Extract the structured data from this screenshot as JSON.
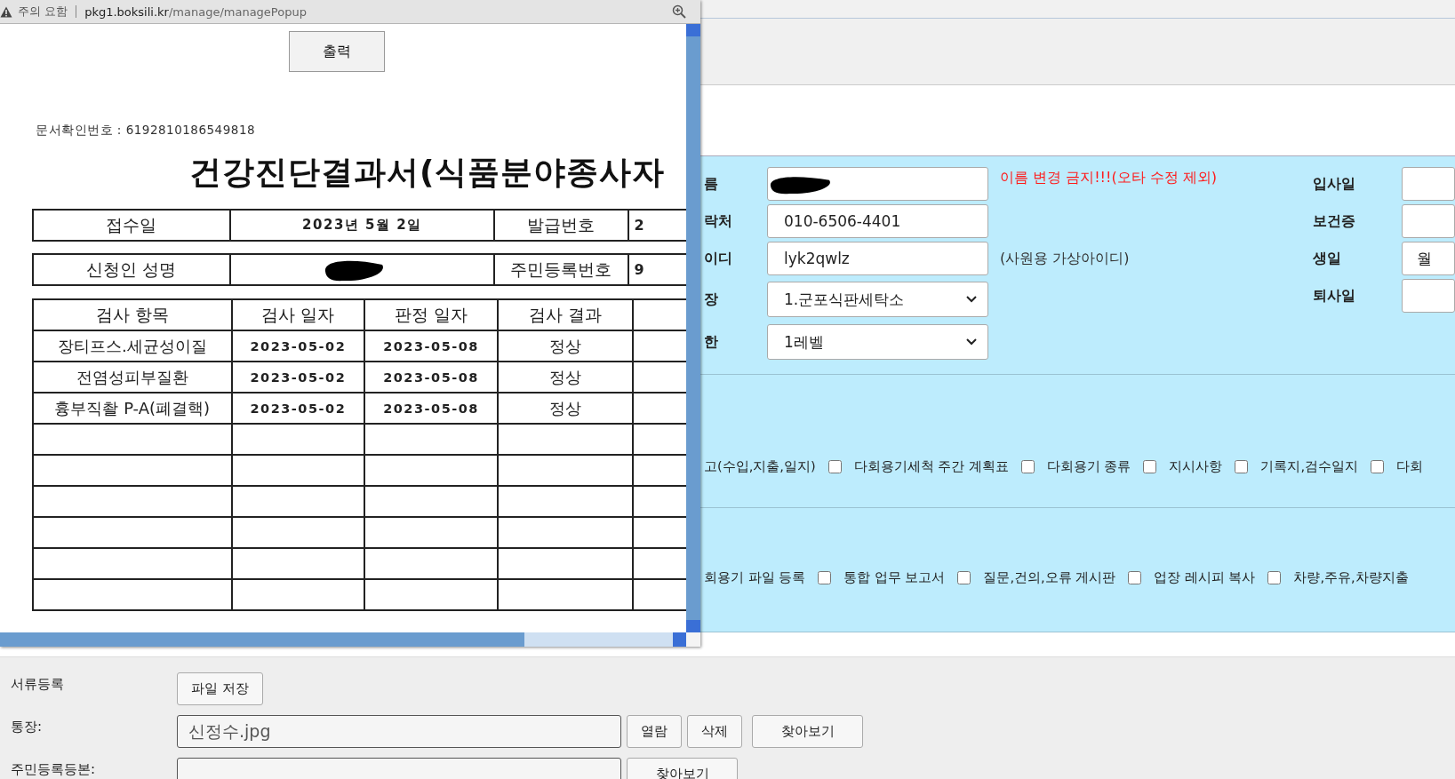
{
  "popup": {
    "security_label": "주의 요함",
    "url_host": "pkg1.boksili.kr",
    "url_path": "/manage/managePopup",
    "print_button": "출력",
    "doc_number": "문서확인번호 : 6192810186549818",
    "title": "건강진단결과서(식품분야종사자",
    "info_rows": [
      [
        {
          "kind": "label",
          "text": "접수일"
        },
        {
          "kind": "value",
          "text": "2023년 5월 2일"
        },
        {
          "kind": "label",
          "text": "발급번호"
        },
        {
          "kind": "cut",
          "text": "2"
        }
      ],
      [
        {
          "kind": "label",
          "text": "신청인 성명"
        },
        {
          "kind": "redacted"
        },
        {
          "kind": "label",
          "text": "주민등록번호"
        },
        {
          "kind": "cut",
          "text": "9"
        }
      ]
    ],
    "results": {
      "columns": [
        "검사 항목",
        "검사 일자",
        "판정 일자",
        "검사 결과"
      ],
      "rows": [
        [
          "장티프스.세균성이질",
          "2023-05-02",
          "2023-05-08",
          "정상"
        ],
        [
          "전염성피부질환",
          "2023-05-02",
          "2023-05-08",
          "정상"
        ],
        [
          "흉부직촬 P-A(폐결핵)",
          "2023-05-02",
          "2023-05-08",
          "정상"
        ]
      ]
    }
  },
  "form": {
    "fields": [
      {
        "label": "름",
        "kind": "redacted",
        "note": {
          "kind": "warning",
          "text": "이름 변경 금지!!!(오타 수정 제외)"
        }
      },
      {
        "label": "락처",
        "kind": "text",
        "value": "010-6506-4401"
      },
      {
        "label": "이디",
        "kind": "text",
        "value": "lyk2qwlz",
        "note": {
          "kind": "hint",
          "text": "(사원용 가상아이디)"
        }
      },
      {
        "label": "장",
        "kind": "select",
        "value": "1.군포식판세탁소"
      },
      {
        "label": "한",
        "kind": "select",
        "value": "1레벨"
      }
    ],
    "right_fields": [
      {
        "label": "입사일"
      },
      {
        "label": "보건증"
      },
      {
        "label": "생일",
        "value": "월"
      },
      {
        "label": "퇴사일"
      }
    ]
  },
  "permission_rows": [
    [
      {
        "label": "고(수입,지출,일지)",
        "checked": false
      },
      {
        "label": "다회용기세척 주간 계획표",
        "checked": false
      },
      {
        "label": "다회용기 종류",
        "checked": false
      },
      {
        "label": "지시사항",
        "checked": false
      },
      {
        "label": "기록지,검수일지",
        "checked": false
      },
      {
        "label": "다회"
      }
    ],
    [
      {
        "label": "회용기 파일 등록",
        "checked": false
      },
      {
        "label": "통합 업무 보고서",
        "checked": false
      },
      {
        "label": "질문,건의,오류 게시판",
        "checked": false
      },
      {
        "label": "업장 레시피 복사",
        "checked": false
      },
      {
        "label": "차량,주유,차량지출"
      }
    ]
  ],
  "documents": {
    "label": "서류등록",
    "save_button": "파일 저장",
    "files": [
      {
        "label": "통장:",
        "value": "신정수.jpg",
        "buttons": [
          "열람",
          "삭제"
        ],
        "browse": "찾아보기"
      },
      {
        "label": "주민등록등본:",
        "browse": "찾아보기"
      }
    ]
  }
}
